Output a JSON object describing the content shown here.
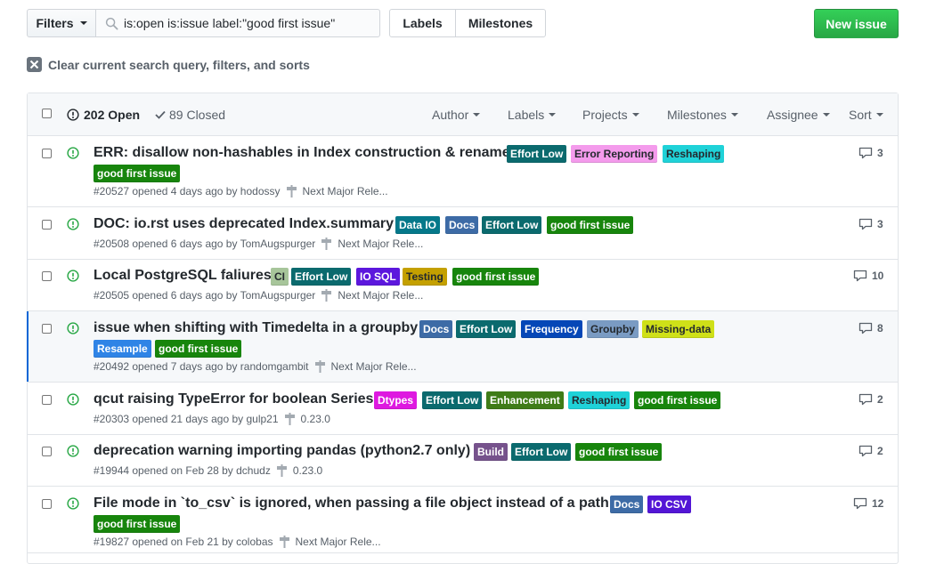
{
  "toolbar": {
    "filters_label": "Filters",
    "search_value": "is:open is:issue label:\"good first issue\"",
    "labels_label": "Labels",
    "milestones_label": "Milestones",
    "new_issue_label": "New issue",
    "clear_label": "Clear current search query, filters, and sorts"
  },
  "header": {
    "open_count": "202 Open",
    "closed_count": "89 Closed",
    "filters": [
      "Author",
      "Labels",
      "Projects",
      "Milestones",
      "Assignee",
      "Sort"
    ]
  },
  "colors": {
    "Effort Low": "#0b6a6e",
    "Error Reporting": "#f49bec",
    "Reshaping": "#1fd2d8",
    "good first issue": "#17850c",
    "Data IO": "#05788a",
    "Docs": "#3d6ba6",
    "CI": "#a7c59a",
    "IO SQL": "#5c17dd",
    "Testing": "#c4a000",
    "Frequency": "#0547b7",
    "Groupby": "#7a9bc3",
    "Missing-data": "#cfe018",
    "Resample": "#2f84e6",
    "Dtypes": "#de19e0",
    "Enhancement": "#3f7c18",
    "Build": "#76528c",
    "IO CSV": "#5316d6"
  },
  "issues": [
    {
      "title": "ERR: disallow non-hashables in Index construction & rename",
      "labels": [
        "Effort Low",
        "Error Reporting",
        "Reshaping",
        "good first issue"
      ],
      "meta": "#20527 opened 4 days ago by hodossy",
      "milestone": "Next Major Rele...",
      "comments": "3"
    },
    {
      "title": "DOC: io.rst uses deprecated Index.summary",
      "labels": [
        "Data IO",
        "Docs",
        "Effort Low",
        "good first issue"
      ],
      "meta": "#20508 opened 6 days ago by TomAugspurger",
      "milestone": "Next Major Rele...",
      "comments": "3"
    },
    {
      "title": "Local PostgreSQL faliures",
      "labels": [
        "CI",
        "Effort Low",
        "IO SQL",
        "Testing",
        "good first issue"
      ],
      "meta": "#20505 opened 6 days ago by TomAugspurger",
      "milestone": "Next Major Rele...",
      "comments": "10"
    },
    {
      "title": "issue when shifting with Timedelta in a groupby",
      "labels": [
        "Docs",
        "Effort Low",
        "Frequency",
        "Groupby",
        "Missing-data",
        "Resample",
        "good first issue"
      ],
      "meta": "#20492 opened 7 days ago by randomgambit",
      "milestone": "Next Major Rele...",
      "comments": "8"
    },
    {
      "title": "qcut raising TypeError for boolean Series",
      "labels": [
        "Dtypes",
        "Effort Low",
        "Enhancement",
        "Reshaping",
        "good first issue"
      ],
      "meta": "#20303 opened 21 days ago by gulp21",
      "milestone": "0.23.0",
      "comments": "2"
    },
    {
      "title": "deprecation warning importing pandas (python2.7 only)",
      "labels": [
        "Build",
        "Effort Low",
        "good first issue"
      ],
      "meta": "#19944 opened on Feb 28 by dchudz",
      "milestone": "0.23.0",
      "comments": "2"
    },
    {
      "title": "File mode in `to_csv` is ignored, when passing a file object instead of a path",
      "labels": [
        "Docs",
        "IO CSV",
        "good first issue"
      ],
      "meta": "#19827 opened on Feb 21 by colobas",
      "milestone": "Next Major Rele...",
      "comments": "12"
    }
  ]
}
